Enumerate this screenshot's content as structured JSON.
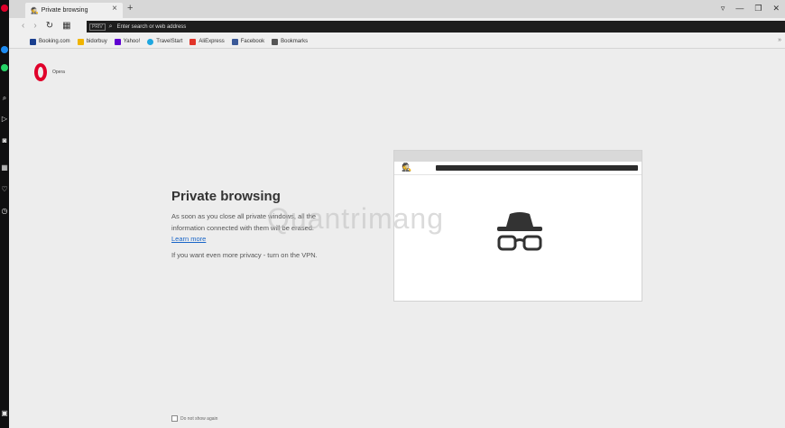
{
  "browser": {
    "tab_title": "Private browsing",
    "new_tab_symbol": "+",
    "tab_close_symbol": "×",
    "address_placeholder": "Enter search or web address",
    "private_badge": "PRIV",
    "window_controls": [
      "▿",
      "—",
      "❐",
      "✕"
    ]
  },
  "bookmarks": [
    {
      "label": "Booking.com",
      "color": "#1a3f8f"
    },
    {
      "label": "bidorbuy",
      "color": "#f0b400"
    },
    {
      "label": "Yahoo!",
      "color": "#5f01d1"
    },
    {
      "label": "TravelStart",
      "color": "#1ea7e0"
    },
    {
      "label": "AliExpress",
      "color": "#e2352a"
    },
    {
      "label": "Facebook",
      "color": "#3b5998"
    },
    {
      "label": "Bookmarks",
      "color": "#555555"
    }
  ],
  "logo": {
    "name": "Opera"
  },
  "page": {
    "heading": "Private browsing",
    "description": "As soon as you close all private windows, all the information connected with them will be erased.",
    "learn_more": "Learn more",
    "vpn_hint": "If you want even more privacy - turn on the VPN.",
    "dont_show": "Do not show again"
  },
  "watermark": "Quantrimang",
  "colors": {
    "accent": "#e0002a",
    "link": "#1a66c8"
  }
}
